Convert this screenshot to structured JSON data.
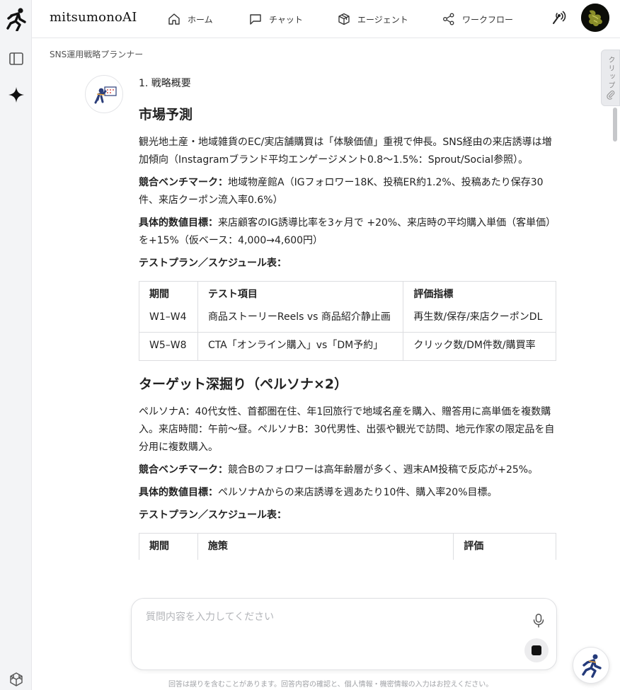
{
  "header": {
    "brand": "mitsumonoAI",
    "nav": [
      {
        "label": "ホーム",
        "icon": "home-icon"
      },
      {
        "label": "チャット",
        "icon": "chat-icon"
      },
      {
        "label": "エージェント",
        "icon": "cube-icon"
      },
      {
        "label": "ワークフロー",
        "icon": "share-icon"
      }
    ]
  },
  "breadcrumb": "SNS運用戦略プランナー",
  "clip": {
    "label": "クリップ"
  },
  "message": {
    "section_num": "1. 戦略概要",
    "market": {
      "heading": "市場予測",
      "intro": "観光地土産・地域雑貨のEC/実店舗購買は「体験価値」重視で伸長。SNS経由の来店誘導は増加傾向（Instagramブランド平均エンゲージメント0.8〜1.5%：Sprout/Social参照）。",
      "benchmark_label": "競合ベンチマーク：",
      "benchmark_text": "地域物産館A（IGフォロワー18K、投稿ER約1.2%、投稿あたり保存30件、来店クーポン流入率0.6%）",
      "target_label": "具体的数値目標：",
      "target_text": "来店顧客のIG誘導比率を3ヶ月で +20%、来店時の平均購入単価（客単価）を+15%（仮ベース：4,000→4,600円）",
      "plan_label": "テストプラン／スケジュール表：",
      "table": {
        "headers": [
          "期間",
          "テスト項目",
          "評価指標"
        ],
        "rows": [
          [
            "W1–W4",
            "商品ストーリーReels vs 商品紹介静止画",
            "再生数/保存/来店クーポンDL"
          ],
          [
            "W5–W8",
            "CTA「オンライン購入」vs「DM予約」",
            "クリック数/DM件数/購買率"
          ]
        ]
      }
    },
    "persona": {
      "heading": "ターゲット深掘り（ペルソナ×2）",
      "intro": "ペルソナA：40代女性、首都圏在住、年1回旅行で地域名産を購入、贈答用に高単価を複数購入。来店時間：午前〜昼。ペルソナB：30代男性、出張や観光で訪問、地元作家の限定品を自分用に複数購入。",
      "benchmark_label": "競合ベンチマーク：",
      "benchmark_text": "競合Bのフォロワーは高年齢層が多く、週末AM投稿で反応が+25%。",
      "target_label": "具体的数値目標：",
      "target_text": "ペルソナAからの来店誘導を週あたり10件、購入率20%目標。",
      "plan_label": "テストプラン／スケジュール表：",
      "table_headers": [
        "期間",
        "施策",
        "評価"
      ]
    }
  },
  "input": {
    "placeholder": "質問内容を入力してください"
  },
  "disclaimer": "回答は誤りを含むことがあります。回答内容の確認と、個人情報・機密情報の入力はお控えください。"
}
